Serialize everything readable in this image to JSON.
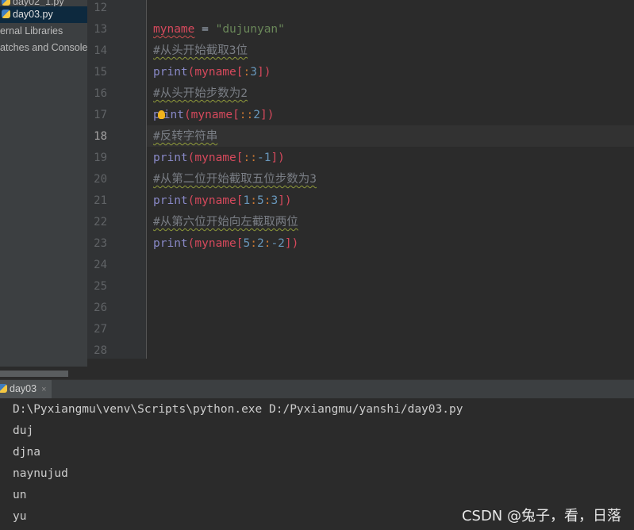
{
  "project_panel": {
    "items": [
      {
        "label": "day02_1.py",
        "selected": false
      },
      {
        "label": "day03.py",
        "selected": true
      },
      {
        "label": "ernal Libraries",
        "selected": false
      },
      {
        "label": "atches and Consoles",
        "selected": false
      }
    ]
  },
  "editor": {
    "line_numbers": [
      "12",
      "13",
      "14",
      "15",
      "16",
      "17",
      "18",
      "19",
      "20",
      "21",
      "22",
      "23",
      "24",
      "25",
      "26",
      "27",
      "28"
    ],
    "current_line": "18",
    "lines": [
      {
        "num": "12",
        "tokens": []
      },
      {
        "num": "13",
        "tokens": [
          {
            "t": "myname",
            "k": "var"
          },
          {
            "t": " = ",
            "k": "op"
          },
          {
            "t": "\"dujunyan\"",
            "k": "str"
          }
        ]
      },
      {
        "num": "14",
        "tokens": [
          {
            "t": "#从头开始截取3位",
            "k": "cmt"
          }
        ]
      },
      {
        "num": "15",
        "tokens": [
          {
            "t": "print",
            "k": "fn"
          },
          {
            "t": "(",
            "k": "brk"
          },
          {
            "t": "myname",
            "k": "arg"
          },
          {
            "t": "[",
            "k": "brk"
          },
          {
            "t": ":",
            "k": "punc"
          },
          {
            "t": "3",
            "k": "num"
          },
          {
            "t": "])",
            "k": "brk"
          }
        ]
      },
      {
        "num": "16",
        "tokens": [
          {
            "t": "#从头开始步数为2",
            "k": "cmt"
          }
        ]
      },
      {
        "num": "17",
        "tokens": [
          {
            "t": "p",
            "k": "fn"
          },
          {
            "t": "",
            "k": "bulb"
          },
          {
            "t": "int",
            "k": "fn"
          },
          {
            "t": "(",
            "k": "brk"
          },
          {
            "t": "myname",
            "k": "arg"
          },
          {
            "t": "[",
            "k": "brk"
          },
          {
            "t": "::",
            "k": "punc"
          },
          {
            "t": "2",
            "k": "num"
          },
          {
            "t": "])",
            "k": "brk"
          }
        ]
      },
      {
        "num": "18",
        "tokens": [
          {
            "t": "#反转字符串",
            "k": "cmt"
          }
        ]
      },
      {
        "num": "19",
        "tokens": [
          {
            "t": "print",
            "k": "fn"
          },
          {
            "t": "(",
            "k": "brk"
          },
          {
            "t": "myname",
            "k": "arg"
          },
          {
            "t": "[",
            "k": "brk"
          },
          {
            "t": "::",
            "k": "punc"
          },
          {
            "t": "-1",
            "k": "num"
          },
          {
            "t": "])",
            "k": "brk"
          }
        ]
      },
      {
        "num": "20",
        "tokens": [
          {
            "t": "#从第二位开始截取五位步数为3",
            "k": "cmt"
          }
        ]
      },
      {
        "num": "21",
        "tokens": [
          {
            "t": "print",
            "k": "fn"
          },
          {
            "t": "(",
            "k": "brk"
          },
          {
            "t": "myname",
            "k": "arg"
          },
          {
            "t": "[",
            "k": "brk"
          },
          {
            "t": "1",
            "k": "num"
          },
          {
            "t": ":",
            "k": "punc"
          },
          {
            "t": "5",
            "k": "num"
          },
          {
            "t": ":",
            "k": "punc"
          },
          {
            "t": "3",
            "k": "num"
          },
          {
            "t": "])",
            "k": "brk"
          }
        ]
      },
      {
        "num": "22",
        "tokens": [
          {
            "t": "#从第六位开始向左截取两位",
            "k": "cmt"
          }
        ]
      },
      {
        "num": "23",
        "tokens": [
          {
            "t": "print",
            "k": "fn"
          },
          {
            "t": "(",
            "k": "brk"
          },
          {
            "t": "myname",
            "k": "arg"
          },
          {
            "t": "[",
            "k": "brk"
          },
          {
            "t": "5",
            "k": "num"
          },
          {
            "t": ":",
            "k": "punc"
          },
          {
            "t": "2",
            "k": "num"
          },
          {
            "t": ":",
            "k": "punc"
          },
          {
            "t": "-2",
            "k": "num"
          },
          {
            "t": "])",
            "k": "brk"
          }
        ]
      },
      {
        "num": "24",
        "tokens": []
      },
      {
        "num": "25",
        "tokens": []
      },
      {
        "num": "26",
        "tokens": []
      },
      {
        "num": "27",
        "tokens": []
      },
      {
        "num": "28",
        "tokens": []
      }
    ]
  },
  "run": {
    "tab_label": "day03",
    "close_glyph": "×",
    "output_lines": [
      "D:\\Pyxiangmu\\venv\\Scripts\\python.exe D:/Pyxiangmu/yanshi/day03.py",
      "duj",
      "djna",
      "naynujud",
      "un",
      "yu"
    ]
  },
  "watermark": "CSDN @兔子，看，日落",
  "colors": {
    "editor_bg": "#2b2b2b",
    "gutter_bg": "#313335",
    "panel_bg": "#3c3f41",
    "keyword_print": "#8888c6",
    "identifier": "#d6495c",
    "string": "#6a8759",
    "comment": "#7a7e85",
    "number": "#6897bb"
  }
}
